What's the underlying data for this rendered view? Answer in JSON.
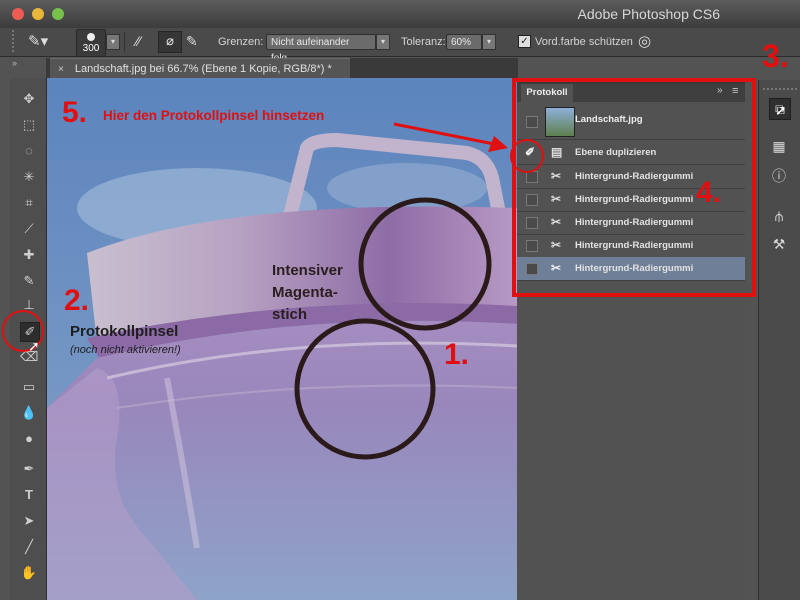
{
  "window": {
    "title": "Adobe Photoshop CS6"
  },
  "options": {
    "brush_size": "300",
    "grenzen_label": "Grenzen:",
    "grenzen_value": "Nicht aufeinander folg.",
    "toleranz_label": "Toleranz:",
    "toleranz_value": "60%",
    "vordfarbe_label": "Vord.farbe schützen"
  },
  "document": {
    "tab_label": "Landschaft.jpg bei 66.7% (Ebene 1 Kopie, RGB/8*) *"
  },
  "panel": {
    "title": "Protokoll",
    "snapshot_label": "Landschaft.jpg",
    "history": [
      {
        "label": "Ebene duplizieren"
      },
      {
        "label": "Hintergrund-Radiergummi"
      },
      {
        "label": "Hintergrund-Radiergummi"
      },
      {
        "label": "Hintergrund-Radiergummi"
      },
      {
        "label": "Hintergrund-Radiergummi"
      },
      {
        "label": "Hintergrund-Radiergummi"
      }
    ]
  },
  "annotations": {
    "n1": "1.",
    "n2": "2.",
    "n3": "3.",
    "n4": "4.",
    "n5": "5.",
    "hint5": "Hier den Protokollpinsel hinsetzen",
    "tool_name": "Protokollpinsel",
    "tool_note": "(noch nicht aktivieren!)",
    "magenta_line1": "Intensiver",
    "magenta_line2": "Magenta-",
    "magenta_line3": "stich"
  },
  "colors": {
    "annotation_red": "#e11010",
    "panel_bg": "#525252",
    "selected_row": "#6e7f97"
  }
}
